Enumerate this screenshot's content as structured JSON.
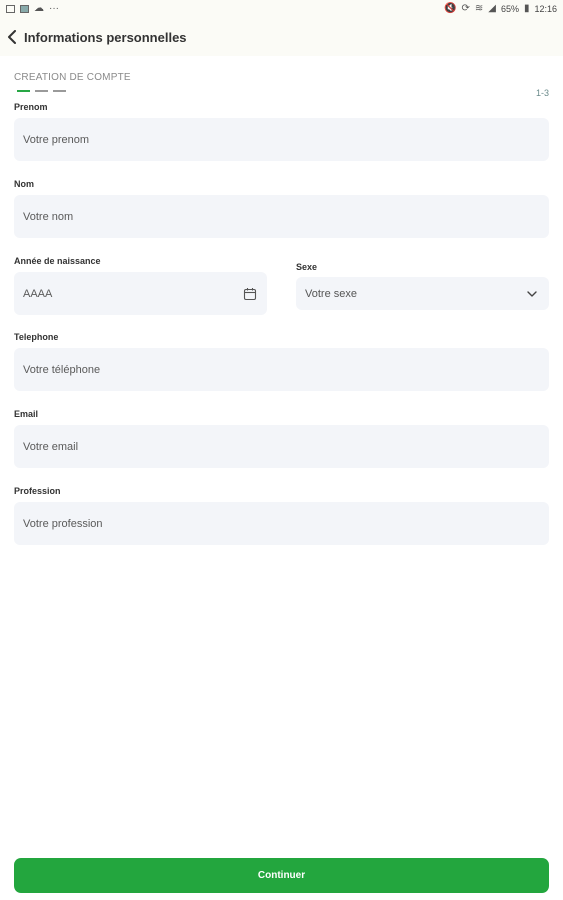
{
  "status_bar": {
    "battery": "65%",
    "time": "12:16",
    "left_icons": [
      "image-icon",
      "app-icon",
      "cloud-icon",
      "more-icon"
    ],
    "right_icons": [
      "mute-icon",
      "sync-icon",
      "wifi-icon",
      "signal-icon",
      "battery-icon"
    ]
  },
  "header": {
    "title": "Informations personnelles",
    "back_icon": "chevron-left-icon"
  },
  "stepper": {
    "title": "CREATION DE COMPTE",
    "count": "1-3",
    "current_step": 1,
    "total_steps": 3
  },
  "form": {
    "prenom": {
      "label": "Prenom",
      "placeholder": "Votre prenom"
    },
    "nom": {
      "label": "Nom",
      "placeholder": "Votre nom"
    },
    "annee": {
      "label": "Année de naissance",
      "placeholder": "AAAA",
      "icon": "calendar-icon"
    },
    "sexe": {
      "label": "Sexe",
      "value": "Votre sexe",
      "icon": "chevron-down-icon"
    },
    "telephone": {
      "label": "Telephone",
      "placeholder": "Votre téléphone"
    },
    "email": {
      "label": "Email",
      "placeholder": "Votre email"
    },
    "profession": {
      "label": "Profession",
      "placeholder": "Votre profession"
    }
  },
  "actions": {
    "continue_label": "Continuer"
  },
  "colors": {
    "accent": "#23a63e",
    "field_bg": "#f3f5f9",
    "header_bg": "#fbfbf6"
  }
}
